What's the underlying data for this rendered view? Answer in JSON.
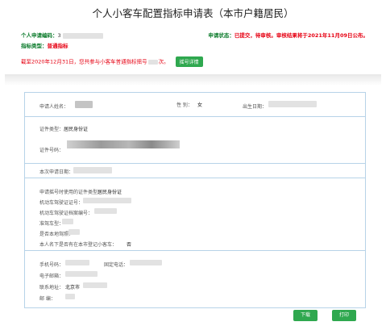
{
  "title": "个人小客车配置指标申请表（本市户籍居民）",
  "header": {
    "code_label": "个人申请编码：",
    "code_value": "3",
    "type_label": "指标类型：",
    "type_value": "普通指标",
    "status_label": "申请状态：",
    "status_value": "已提交，待审核。审核结果将于2021年11月09日公布。"
  },
  "notice": {
    "text": "截至2020年12月31日，您共参与小客车普通指标摇号",
    "suffix": "次。",
    "detail_button": "摇号详情"
  },
  "form": {
    "name_label": "申请人姓名：",
    "gender_label": "性  别：",
    "gender_value": "女",
    "birth_label": "出生日期：",
    "id_type_label": "证件类型：",
    "id_type_value": "居民身份证",
    "id_number_label": "证件号码：",
    "apply_date_label": "本次申请日期：",
    "reg_id_type_label": "申请摇号时使用的证件类型：",
    "reg_id_type_value": "居民身份证",
    "driver_license_label": "机动车驾驶证证号：",
    "driver_file_label": "机动车驾驶证档案编号：",
    "vehicle_type_label": "准驾车型：",
    "local_license_label": "是否本地驾照：",
    "registered_label": "本人名下是否有在本市登记小客车：",
    "registered_value": "否",
    "mobile_label": "手机号码：",
    "phone_label": "固定电话：",
    "email_label": "电子邮箱：",
    "address_label": "联系地址：",
    "address_value": "北京市",
    "postcode_label": "邮    编："
  },
  "footer": {
    "download_label": "下载",
    "print_label": "打印"
  },
  "colors": {
    "accent_green": "#2fa84f",
    "status_red": "#e60012",
    "label_green": "#0a7a2a",
    "border_blue": "#b7d3e8"
  }
}
